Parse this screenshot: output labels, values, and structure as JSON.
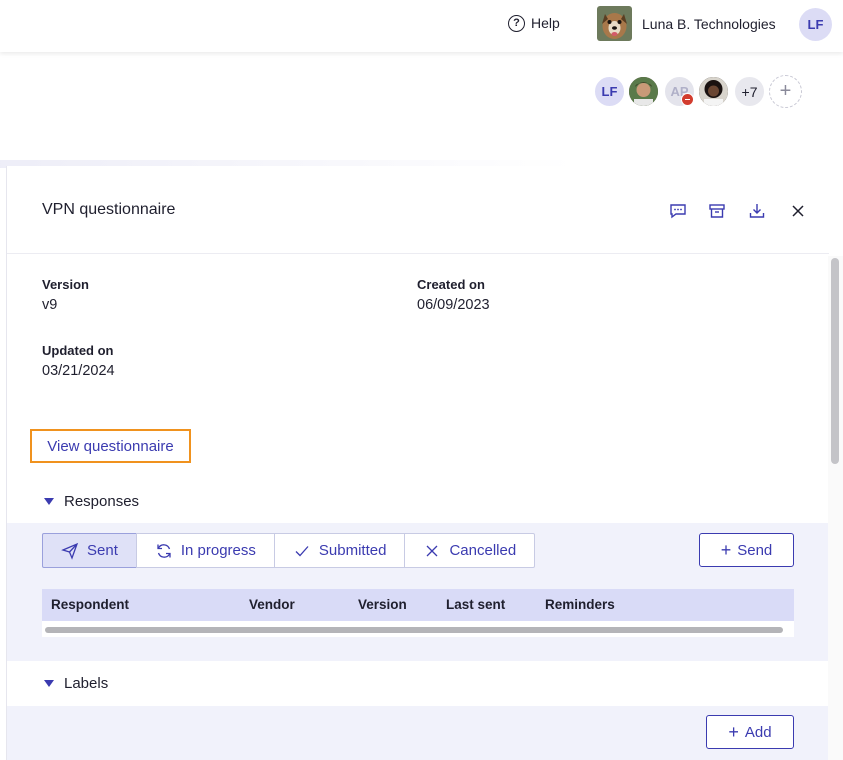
{
  "topbar": {
    "help_label": "Help",
    "org_name": "Luna B. Technologies",
    "user_initials": "LF"
  },
  "collaborators": {
    "first_initials": "LF",
    "third_initials": "AP",
    "overflow_count": "+7",
    "add_symbol": "+"
  },
  "panel": {
    "title": "VPN questionnaire",
    "fields": {
      "version_label": "Version",
      "version_value": "v9",
      "created_label": "Created on",
      "created_value": "06/09/2023",
      "updated_label": "Updated on",
      "updated_value": "03/21/2024"
    },
    "view_link": "View questionnaire"
  },
  "responses": {
    "section_label": "Responses",
    "filters": [
      {
        "label": "Sent",
        "icon": "paper-plane-icon",
        "active": true
      },
      {
        "label": "In progress",
        "icon": "refresh-icon",
        "active": false
      },
      {
        "label": "Submitted",
        "icon": "checkmark-icon",
        "active": false
      },
      {
        "label": "Cancelled",
        "icon": "x-icon",
        "active": false
      }
    ],
    "send_label": "Send",
    "columns": [
      "Respondent",
      "Vendor",
      "Version",
      "Last sent",
      "Reminders"
    ]
  },
  "labels": {
    "section_label": "Labels",
    "add_label": "Add"
  },
  "colors": {
    "accent": "#3b3bb0",
    "highlight": "#f0921e",
    "section_bg": "#f1f2fb",
    "table_header_bg": "#d9dbf7"
  }
}
